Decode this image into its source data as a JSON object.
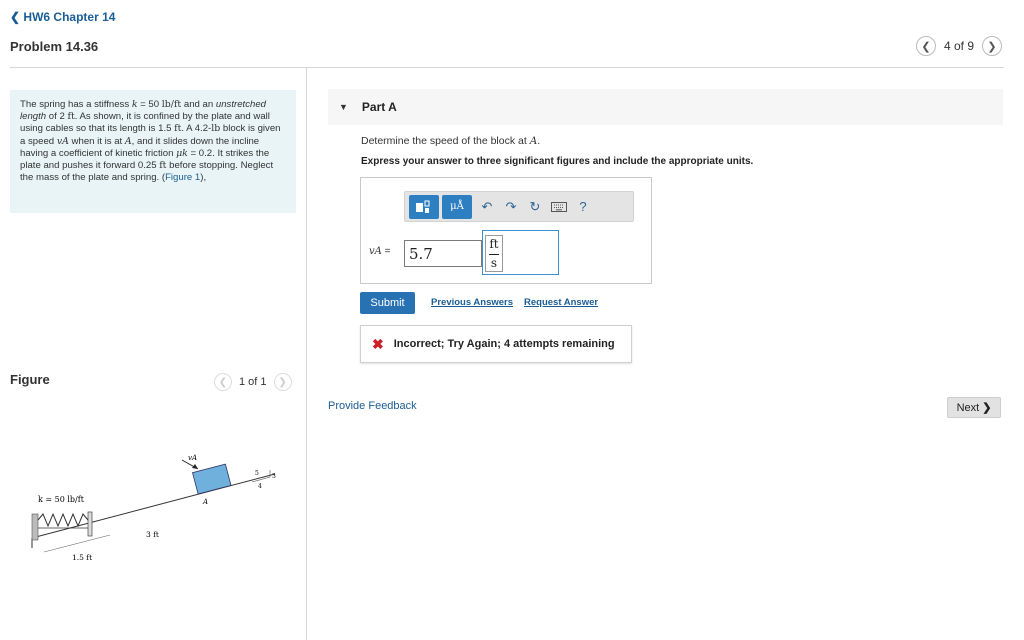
{
  "nav": {
    "back_label": "HW6 Chapter 14",
    "problem_title": "Problem 14.36",
    "page_current": "4 of 9"
  },
  "problem": {
    "t1": "The spring has a stiffness ",
    "k_sym": "k",
    "t2": " = 50 ",
    "k_unit": "lb/ft",
    "t3": " and an ",
    "italic1": "unstretched length",
    "t4": " of 2 ",
    "ft1": "ft",
    "t5": ". As shown, it is confined by the plate and wall using cables so that its length is 1.5 ",
    "ft2": "ft",
    "t6": ". A 4.2-",
    "lb": "lb",
    "t7": " block is given a speed ",
    "vA": "vA",
    "t8": " when it is at ",
    "A": "A",
    "t9": ", and it slides down the incline having a coefficient of kinetic friction ",
    "mu": "μk",
    "t10": " = 0.2. It strikes the plate and pushes it forward 0.25 ",
    "ft3": "ft",
    "t11": " before stopping. Neglect the mass of the plate and spring. (",
    "figure_link": "Figure 1",
    "t12": "),"
  },
  "figure": {
    "title": "Figure",
    "pager": "1 of 1",
    "labels": {
      "k": "k  = 50 lb/ft",
      "len_small": "1.5 ft",
      "len_big": "3 ft",
      "v": "vA",
      "point": "A",
      "slope_5": "5",
      "slope_3": "3",
      "slope_4": "4"
    }
  },
  "part": {
    "label": "Part A",
    "question_prefix": "Determine the speed of the block at ",
    "question_var": "A",
    "question_suffix": ".",
    "instruction": "Express your answer to three significant figures and include the appropriate units.",
    "toolbar": {
      "templates_icon": "template-icon",
      "units_label": "μÅ",
      "undo_icon": "undo-icon",
      "redo_icon": "redo-icon",
      "reset_icon": "reset-icon",
      "keyboard_icon": "keyboard-icon",
      "help_label": "?"
    },
    "answer_label": "vA",
    "answer_eq": " = ",
    "answer_value": "5.7",
    "unit_num": "ft",
    "unit_den": "s"
  },
  "actions": {
    "submit": "Submit",
    "previous_answers": "Previous Answers",
    "request_answer": "Request Answer"
  },
  "feedback": {
    "message": "Incorrect; Try Again; 4 attempts remaining",
    "provide_feedback": "Provide Feedback",
    "next": "Next"
  },
  "colors": {
    "link": "#1a5d94",
    "accent": "#2d7fc1",
    "problem_bg": "#e8f4f6",
    "error": "#cc1f27"
  }
}
